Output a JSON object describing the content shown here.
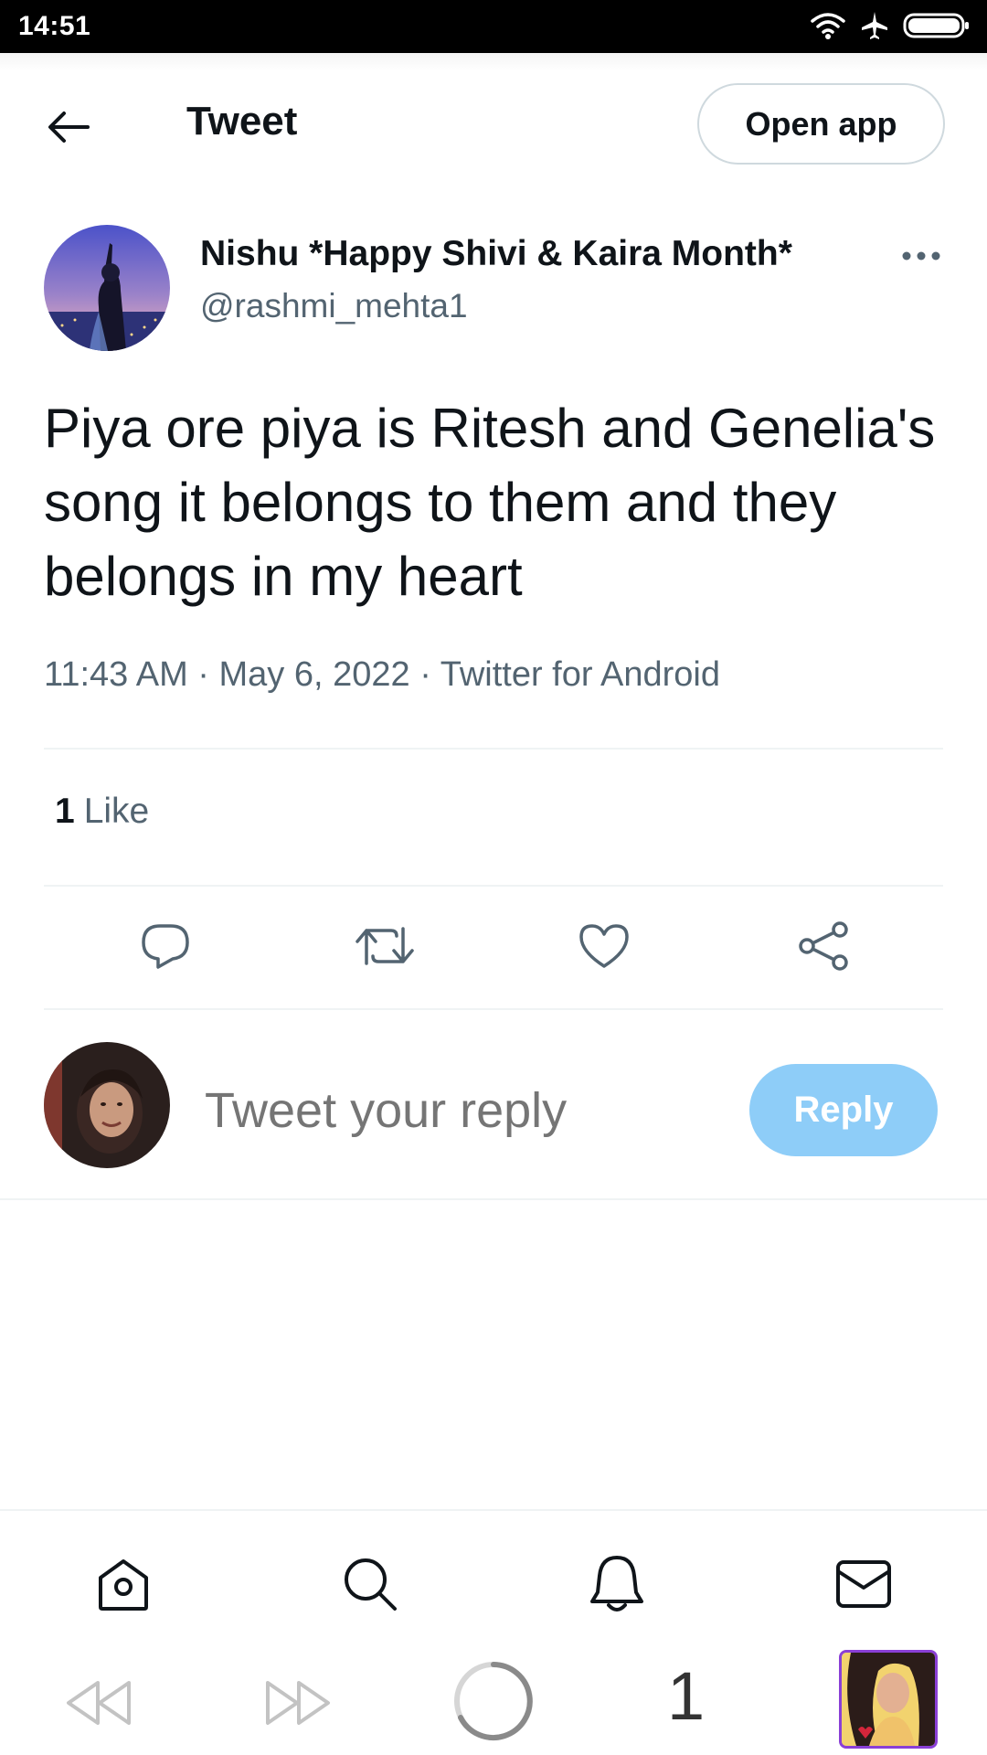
{
  "status_bar": {
    "time": "14:51",
    "icons": [
      "wifi-icon",
      "airplane-mode-icon",
      "battery-icon"
    ]
  },
  "header": {
    "title": "Tweet",
    "open_app_label": "Open app",
    "back_icon": "arrow-left-icon"
  },
  "tweet": {
    "author_name": "Nishu *Happy Shivi & Kaira Month*",
    "author_handle": "@rashmi_mehta1",
    "text": "Piya ore piya is Ritesh and Genelia's song it belongs to them and they belongs in my heart",
    "meta": "11:43 AM · May 6, 2022 · Twitter for Android",
    "like_count": "1",
    "like_label": "Like",
    "actions": [
      "reply-icon",
      "retweet-icon",
      "like-icon",
      "share-icon"
    ]
  },
  "reply": {
    "placeholder": "Tweet your reply",
    "button_label": "Reply"
  },
  "bottom_nav": {
    "items": [
      "home-icon",
      "search-icon",
      "notifications-icon",
      "messages-icon"
    ]
  },
  "browser_bar": {
    "tab_count": "1",
    "items": [
      "back-icon",
      "forward-icon",
      "loading-icon",
      "tabs-count",
      "tab-thumbnail"
    ]
  },
  "colors": {
    "accent": "#1d9bf0",
    "reply_button_disabled": "#8ecdf8",
    "secondary_text": "#536471",
    "primary_text": "#0f1419",
    "divider": "#eff3f4"
  }
}
